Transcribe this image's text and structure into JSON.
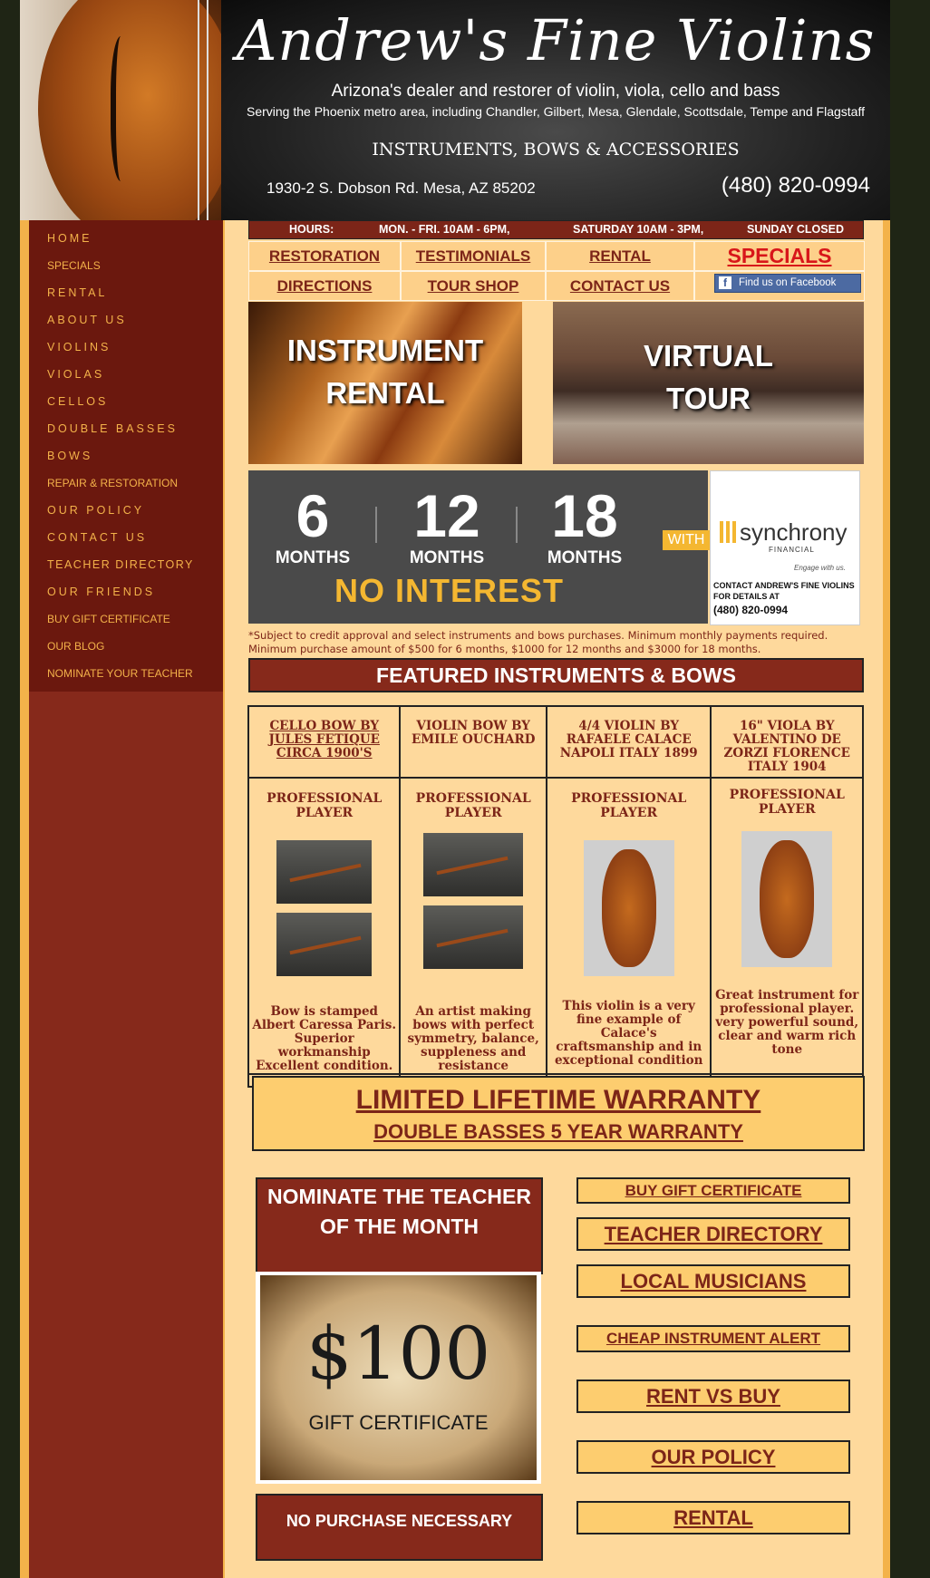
{
  "header": {
    "title": "Andrew's Fine Violins",
    "subtitle": "Arizona's dealer and restorer of violin, viola, cello and bass",
    "serving": "Serving the Phoenix metro area, including Chandler, Gilbert,  Mesa, Glendale, Scottsdale, Tempe and Flagstaff",
    "tagline": "INSTRUMENTS, BOWS & ACCESSORIES",
    "address": "1930-2 S. Dobson Rd. Mesa, AZ 85202",
    "phone": "(480) 820-0994"
  },
  "nav": [
    "HOME",
    "SPECIALS",
    "RENTAL",
    "ABOUT US",
    "VIOLINS",
    "VIOLAS",
    "CELLOS",
    "DOUBLE BASSES",
    "BOWS",
    "REPAIR & RESTORATION",
    "OUR POLICY",
    "CONTACT US",
    "TEACHER DIRECTORY",
    "OUR FRIENDS",
    "BUY GIFT CERTIFICATE",
    "OUR BLOG",
    "NOMINATE YOUR TEACHER"
  ],
  "hours": {
    "label": "HOURS:",
    "weekdays": "MON. - FRI. 10AM - 6PM,",
    "saturday": "SATURDAY 10AM - 3PM,",
    "sunday": "SUNDAY CLOSED"
  },
  "top_links": {
    "restoration": "RESTORATION",
    "testimonials": "TESTIMONIALS",
    "rental": "RENTAL",
    "specials": "SPECIALS",
    "directions": "DIRECTIONS",
    "tour_shop": "TOUR SHOP",
    "contact_us": "CONTACT US",
    "facebook": "Find us on Facebook",
    "facebook_glyph": "f"
  },
  "promos": {
    "rental": [
      "INSTRUMENT",
      "RENTAL"
    ],
    "tour": [
      "VIRTUAL",
      "TOUR"
    ]
  },
  "finance": {
    "plans": [
      {
        "num": "6",
        "unit": "MONTHS"
      },
      {
        "num": "12",
        "unit": "MONTHS"
      },
      {
        "num": "18",
        "unit": "MONTHS"
      }
    ],
    "no_interest": "NO INTEREST",
    "with": "WITH",
    "brand": "synchrony",
    "brand_sub": "FINANCIAL",
    "brand_tag": "Engage with us.",
    "contact": "CONTACT ANDREW'S FINE VIOLINS FOR DETAILS AT",
    "phone": "(480) 820-0994"
  },
  "disclaimer": "*Subject to credit approval and select instruments and bows purchases. Minimum monthly payments required. Minimum purchase amount of $500 for 6 months, $1000 for 12 months and $3000 for 18 months.",
  "featured_title": "FEATURED INSTRUMENTS & BOWS",
  "instruments": [
    {
      "name": "CELLO BOW BY JULES FETIQUE CIRCA 1900'S",
      "level": "PROFESSIONAL PLAYER",
      "desc": "Bow is stamped Albert Caressa Paris. Superior workmanship Excellent condition."
    },
    {
      "name": "VIOLIN BOW BY EMILE OUCHARD",
      "level": "PROFESSIONAL PLAYER",
      "desc": "An artist making bows with perfect symmetry, balance, suppleness and resistance"
    },
    {
      "name": "4/4 VIOLIN BY RAFAELE CALACE NAPOLI ITALY 1899",
      "level": "PROFESSIONAL PLAYER",
      "desc": "This violin is a very fine example of Calace's craftsmanship and in exceptional condition"
    },
    {
      "name": "16\" VIOLA BY VALENTINO DE ZORZI FLORENCE ITALY 1904",
      "level": "PROFESSIONAL PLAYER",
      "desc": "Great instrument for professional player. very powerful sound, clear and warm rich tone"
    }
  ],
  "warranty": {
    "line1": "LIMITED LIFETIME WARRANTY",
    "line2": "DOUBLE BASSES 5 YEAR WARRANTY"
  },
  "nominate": {
    "title": "NOMINATE THE TEACHER OF THE MONTH",
    "amount": "$100",
    "cert": "GIFT CERTIFICATE",
    "no_purchase": "NO PURCHASE NECESSARY"
  },
  "right_buttons": {
    "gift": "BUY GIFT CERTIFICATE",
    "teacher_dir": "TEACHER DIRECTORY",
    "local_musicians": "LOCAL MUSICIANS",
    "cheap_alert": "CHEAP INSTRUMENT ALERT",
    "rent_vs_buy": "RENT VS BUY",
    "our_policy": "OUR POLICY",
    "rental": "RENTAL"
  },
  "colors": {
    "brand_maroon": "#86291b",
    "gold": "#f3b24a",
    "cream": "#fed99c",
    "special_red": "#d8161a"
  }
}
